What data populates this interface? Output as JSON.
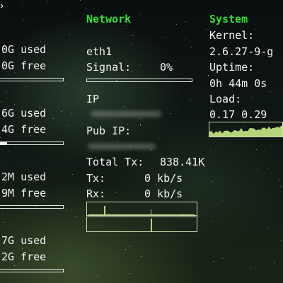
{
  "memory_column": {
    "rows": [
      {
        "used": "0G used",
        "free": "0G free",
        "fill": 0.0
      },
      {
        "used": "6G used",
        "free": "4G free",
        "fill": 0.12
      },
      {
        "used": "2M used",
        "free": "9M free",
        "fill": 0.0
      },
      {
        "used": "7G used",
        "free": "2G free",
        "fill": 0.0
      }
    ]
  },
  "network": {
    "header": "Network",
    "interface": "eth1",
    "signal_label": "Signal:",
    "signal_value": "0%",
    "signal_fill": 0.0,
    "ip_label": "IP",
    "pub_ip_label": "Pub IP:",
    "total_tx_label": "Total Tx:",
    "total_tx_value": "838.41K",
    "tx_label": "Tx:",
    "tx_value": "0 kb/s",
    "rx_label": "Rx:",
    "rx_value": "0 kb/s"
  },
  "system": {
    "header": "System",
    "kernel_label": "Kernel:",
    "kernel_value": "2.6.27-9-g",
    "uptime_label": "Uptime:",
    "uptime_value": "0h 44m 0s",
    "load_label": "Load:",
    "load_value": "0.17 0.29"
  },
  "colors": {
    "header": "#33dd33",
    "text": "#f2f2f2",
    "graph": "#b7d47a"
  }
}
